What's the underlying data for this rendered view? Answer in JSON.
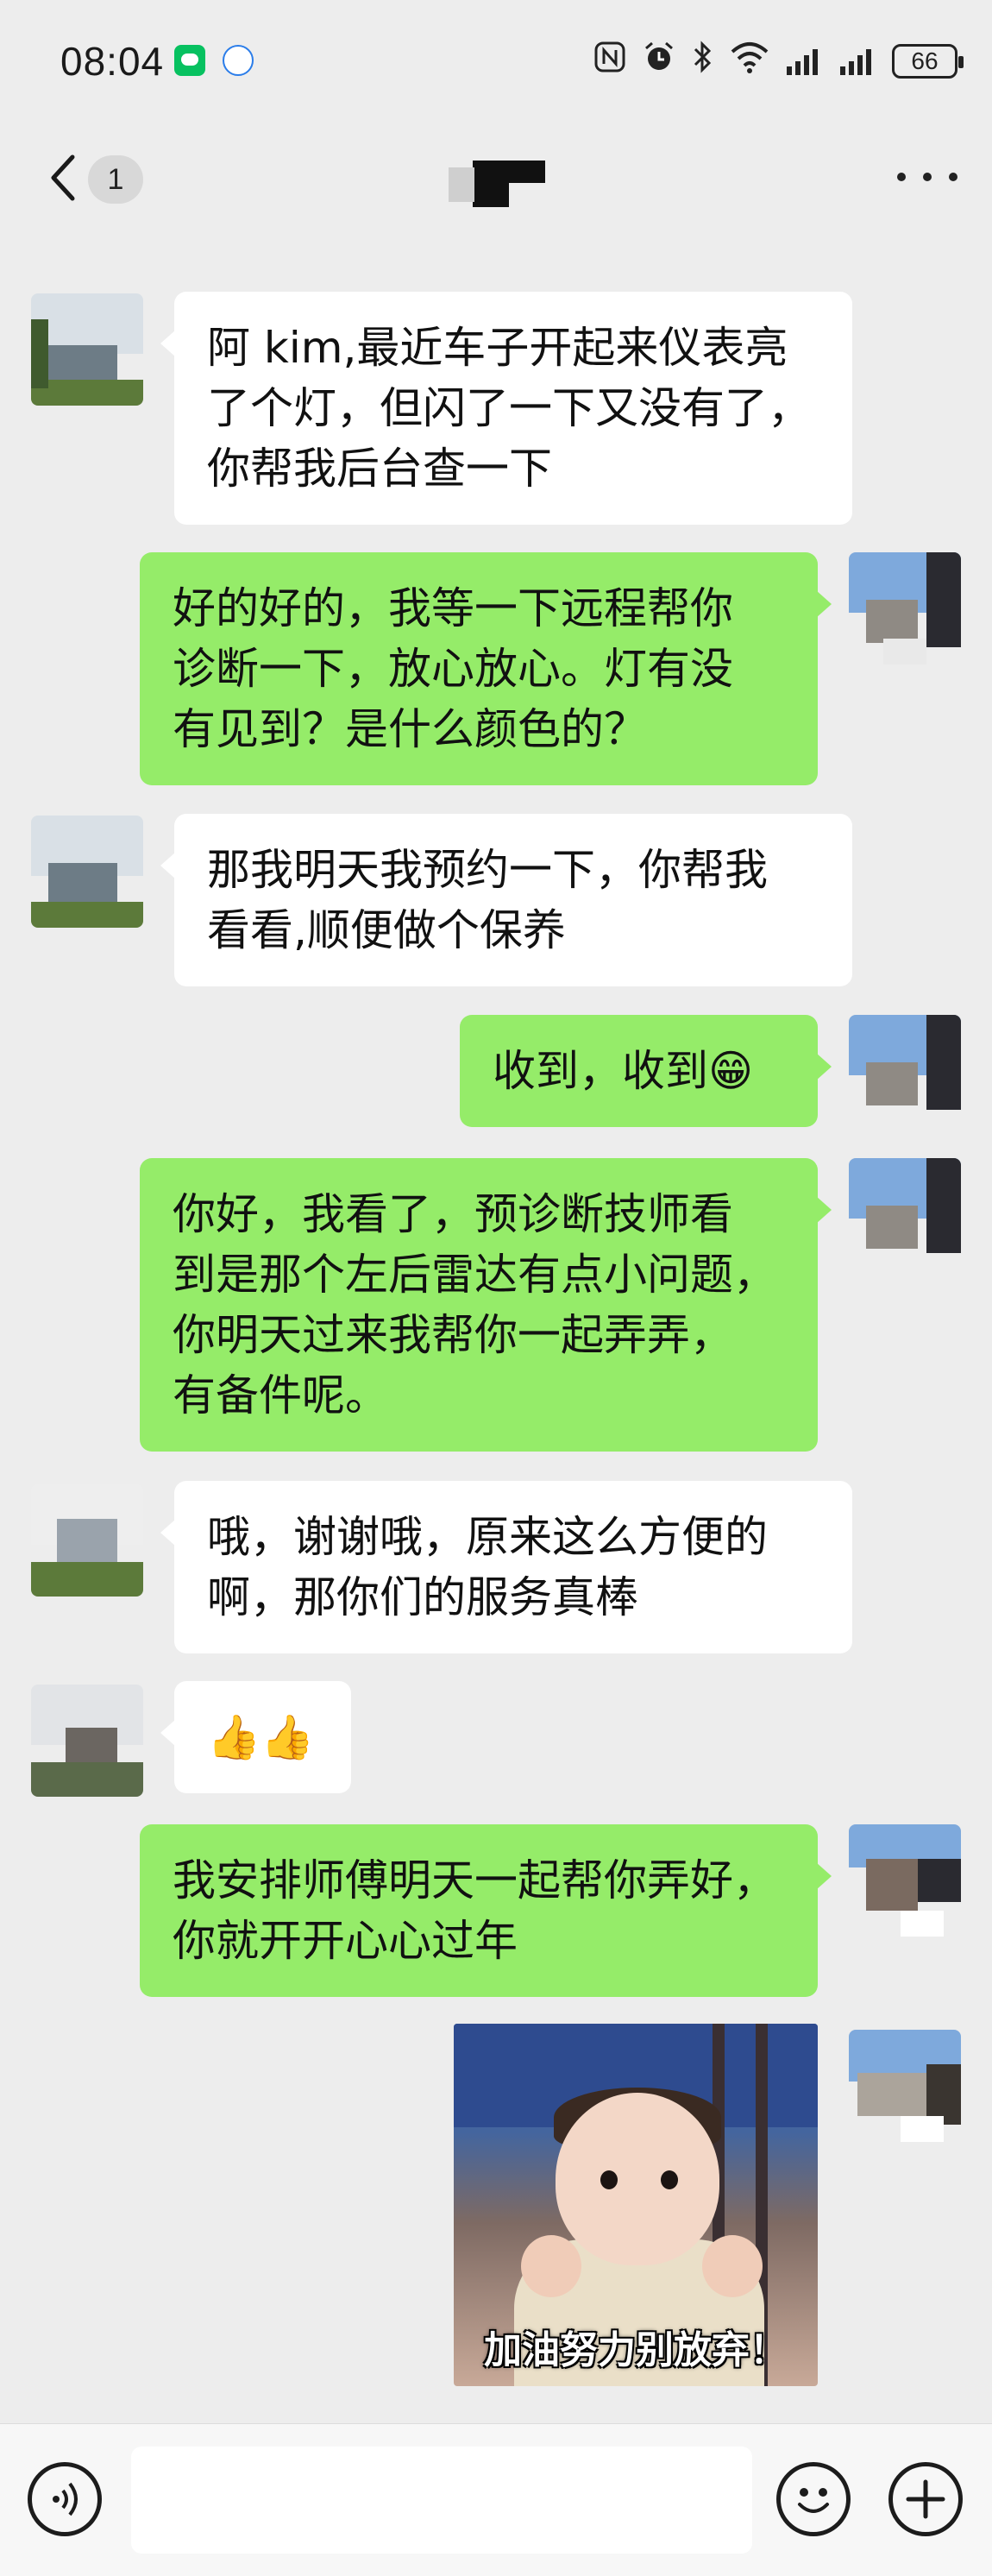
{
  "status_bar": {
    "time": "08:04",
    "battery": "66",
    "icons": [
      "nfc-icon",
      "alarm-icon",
      "bluetooth-icon",
      "wifi-icon",
      "signal-icon",
      "signal-icon",
      "battery-icon"
    ]
  },
  "header": {
    "unread_count": "1",
    "icons": [
      "back-arrow-icon",
      "more-icon"
    ]
  },
  "messages": [
    {
      "side": "left",
      "text": "阿 kim,最近车子开起来仪表亮\n了个灯，但闪了一下又没有了，\n你帮我后台查一下"
    },
    {
      "side": "right",
      "text": "好的好的，我等一下远程帮你\n诊断一下，放心放心。灯有没\n有见到？是什么颜色的？"
    },
    {
      "side": "left",
      "text": "那我明天我预约一下，你帮我\n看看,顺便做个保养"
    },
    {
      "side": "right",
      "text": "收到，收到😁"
    },
    {
      "side": "right",
      "text": "你好，我看了，预诊断技师看\n到是那个左后雷达有点小问题，\n你明天过来我帮你一起弄弄，\n有备件呢。"
    },
    {
      "side": "left",
      "text": "哦，谢谢哦，原来这么方便的\n啊，那你们的服务真棒"
    },
    {
      "side": "left",
      "text": "👍👍"
    },
    {
      "side": "right",
      "text": "我安排师傅明天一起帮你弄好，\n你就开开心心过年"
    },
    {
      "side": "right",
      "type": "sticker",
      "caption": "加油努力别放弃！"
    }
  ],
  "input_bar": {
    "placeholder": "",
    "icons": [
      "voice-icon",
      "emoji-icon",
      "plus-icon"
    ]
  },
  "colors": {
    "background": "#ededed",
    "bubble_self": "#95ec69",
    "bubble_other": "#ffffff"
  }
}
